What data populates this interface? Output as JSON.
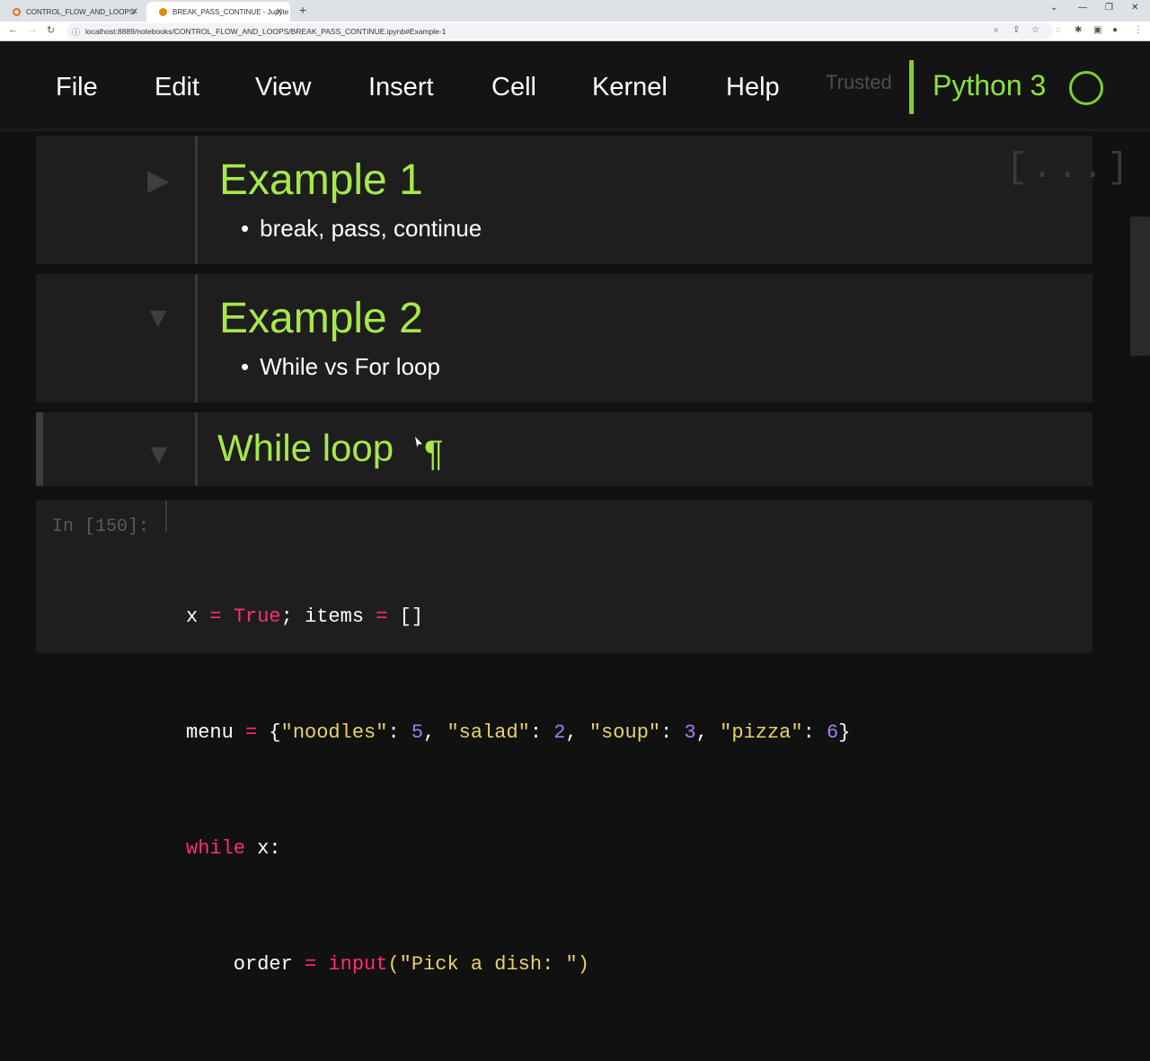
{
  "browser": {
    "tabs": [
      {
        "title": "CONTROL_FLOW_AND_LOOPS/",
        "fav_color": "#e07020"
      },
      {
        "title": "BREAK_PASS_CONTINUE - Jupyte",
        "fav_color": "#e08a10"
      }
    ],
    "url": "localhost:8889/notebooks/CONTROL_FLOW_AND_LOOPS/BREAK_PASS_CONTINUE.ipynb#Example-1"
  },
  "menubar": {
    "items": [
      "File",
      "Edit",
      "View",
      "Insert",
      "Cell",
      "Kernel",
      "Help"
    ],
    "trusted": "Trusted",
    "kernel_name": "Python 3"
  },
  "cells": {
    "example1": {
      "heading": "Example 1",
      "bullet": "break, pass, continue",
      "ellipsis": "[...]"
    },
    "example2": {
      "heading": "Example 2",
      "bullet": "While vs For loop"
    },
    "while_loop": {
      "heading": "While loop",
      "pilcrow": "¶"
    },
    "code": {
      "prompt": "In [150]:",
      "line1": {
        "x": "x",
        "eq": "=",
        "true": "True",
        "rest": "; items ",
        "eq2": "=",
        "list": " []"
      },
      "line2": {
        "menu": "menu ",
        "eq": "=",
        "open": " {",
        "k1": "\"noodles\"",
        "v1": "5",
        "k2": "\"salad\"",
        "v2": "2",
        "k3": "\"soup\"",
        "v3": "3",
        "k4": "\"pizza\"",
        "v4": "6",
        "close": "}"
      },
      "line3": {
        "kw": "while",
        "rest": " x:"
      },
      "line4": {
        "order": "    order ",
        "eq": "=",
        "fn": " input",
        "arg": "(\"Pick a dish: \")"
      }
    }
  },
  "colors": {
    "accent": "#a7e84a",
    "kernel": "#7fd12f"
  }
}
